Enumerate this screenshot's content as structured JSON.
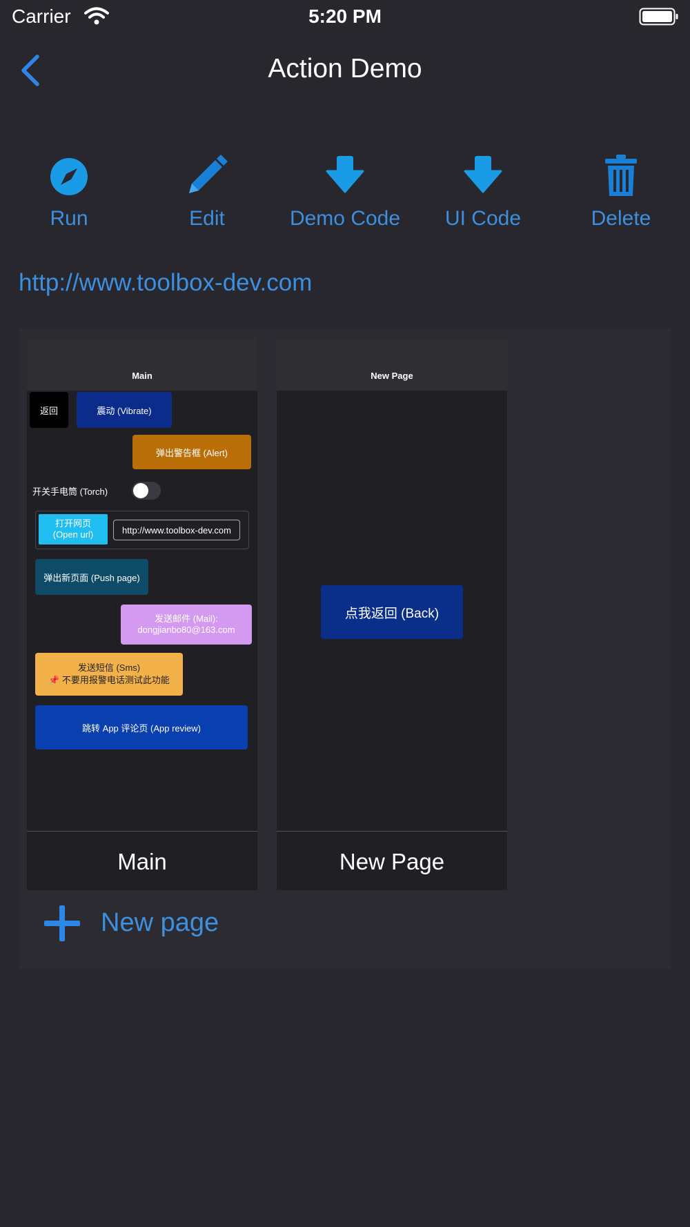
{
  "status": {
    "carrier": "Carrier",
    "time": "5:20 PM"
  },
  "nav": {
    "title": "Action Demo"
  },
  "toolbar": {
    "run": "Run",
    "edit": "Edit",
    "demo_code": "Demo Code",
    "ui_code": "UI Code",
    "delete": "Delete"
  },
  "link": "http://www.toolbox-dev.com",
  "pages": [
    {
      "header": "Main",
      "name": "Main",
      "widgets": {
        "back": "返回",
        "vibrate": "震动 (Vibrate)",
        "alert": "弹出警告框 (Alert)",
        "torch": "开关手电筒 (Torch)",
        "open_url_line1": "打开网页",
        "open_url_line2": "(Open url)",
        "url_value": "http://www.toolbox-dev.com",
        "push_page": "弹出新页面 (Push page)",
        "mail_line1": "发送邮件 (Mail):",
        "mail_line2": "dongjianbo80@163.com",
        "sms_line1": "发送短信 (Sms)",
        "sms_line2": "📌 不要用报警电话测试此功能",
        "app_review": "跳转 App 评论页 (App review)"
      }
    },
    {
      "header": "New Page",
      "name": "New Page",
      "widgets": {
        "back": "点我返回 (Back)"
      }
    }
  ],
  "new_page": "New page",
  "colors": {
    "background": "#27272d",
    "accent": "#3d8fe0",
    "icon_blue": "#1a9be6"
  }
}
